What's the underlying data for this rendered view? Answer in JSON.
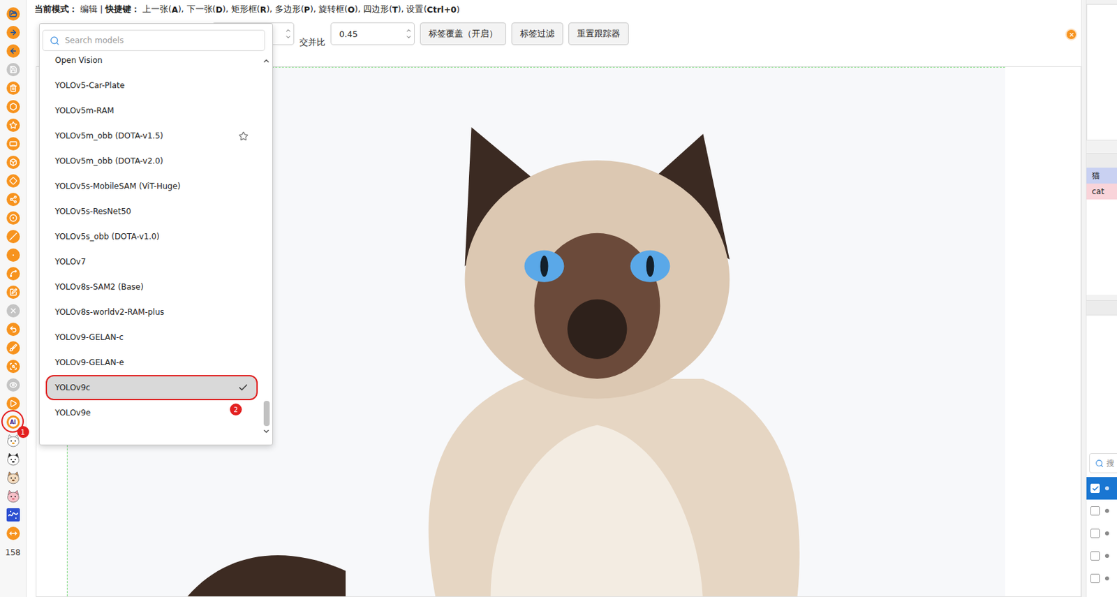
{
  "hint": [
    {
      "text": "当前模式：",
      "bold": true
    },
    {
      "text": " 编辑 | ",
      "bold": false
    },
    {
      "text": "快捷键：",
      "bold": true
    },
    {
      "text": " 上一张(",
      "bold": false
    },
    {
      "text": "A",
      "bold": true
    },
    {
      "text": "), 下一张(",
      "bold": false
    },
    {
      "text": "D",
      "bold": true
    },
    {
      "text": "), 矩形框(",
      "bold": false
    },
    {
      "text": "R",
      "bold": true
    },
    {
      "text": "), 多边形(",
      "bold": false
    },
    {
      "text": "P",
      "bold": true
    },
    {
      "text": "), 旋转框(",
      "bold": false
    },
    {
      "text": "O",
      "bold": true
    },
    {
      "text": "), 四边形(",
      "bold": false
    },
    {
      "text": "T",
      "bold": true
    },
    {
      "text": "), 设置(",
      "bold": false
    },
    {
      "text": "Ctrl+0",
      "bold": true
    },
    {
      "text": ")",
      "bold": false
    }
  ],
  "left_toolbar": {
    "tools": [
      {
        "kind": "round",
        "disabled": false
      },
      {
        "kind": "round",
        "disabled": false
      },
      {
        "kind": "round",
        "disabled": false
      },
      {
        "kind": "round",
        "disabled": true
      },
      {
        "kind": "round",
        "disabled": false
      },
      {
        "kind": "round",
        "disabled": false
      },
      {
        "kind": "round",
        "disabled": false
      },
      {
        "kind": "round",
        "disabled": false
      },
      {
        "kind": "round",
        "disabled": false
      },
      {
        "kind": "round",
        "disabled": false
      },
      {
        "kind": "round",
        "disabled": false
      },
      {
        "kind": "round",
        "disabled": false
      },
      {
        "kind": "round",
        "disabled": false
      },
      {
        "kind": "round",
        "disabled": false
      },
      {
        "kind": "round",
        "disabled": false
      },
      {
        "kind": "round",
        "disabled": false
      },
      {
        "kind": "round",
        "disabled": true
      },
      {
        "kind": "round",
        "disabled": false
      },
      {
        "kind": "round",
        "disabled": false
      },
      {
        "kind": "round",
        "disabled": false
      },
      {
        "kind": "round",
        "disabled": true
      },
      {
        "kind": "round",
        "disabled": false
      },
      {
        "kind": "round",
        "disabled": false,
        "label": "AI",
        "annotation": "1"
      },
      {
        "kind": "mascot",
        "disabled": false
      },
      {
        "kind": "mascot",
        "disabled": false
      },
      {
        "kind": "mascot",
        "disabled": false
      },
      {
        "kind": "mascot",
        "disabled": false
      },
      {
        "kind": "tile",
        "disabled": false
      },
      {
        "kind": "round",
        "disabled": false
      }
    ],
    "count": "158"
  },
  "options": {
    "iou_label": "交并比",
    "iou_value": "0.45",
    "buttons": [
      "标签覆盖（开启）",
      "标签过滤",
      "重置跟踪器"
    ]
  },
  "model_menu": {
    "search_placeholder": "Search models",
    "models": [
      {
        "name": "Open Vision",
        "selected": false,
        "starred": false
      },
      {
        "name": "YOLOv5-Car-Plate",
        "selected": false,
        "starred": false
      },
      {
        "name": "YOLOv5m-RAM",
        "selected": false,
        "starred": false
      },
      {
        "name": "YOLOv5m_obb (DOTA-v1.5)",
        "selected": false,
        "starred": true
      },
      {
        "name": "YOLOv5m_obb (DOTA-v2.0)",
        "selected": false,
        "starred": false
      },
      {
        "name": "YOLOv5s-MobileSAM (ViT-Huge)",
        "selected": false,
        "starred": false
      },
      {
        "name": "YOLOv5s-ResNet50",
        "selected": false,
        "starred": false
      },
      {
        "name": "YOLOv5s_obb (DOTA-v1.0)",
        "selected": false,
        "starred": false
      },
      {
        "name": "YOLOv7",
        "selected": false,
        "starred": false
      },
      {
        "name": "YOLOv8s-SAM2 (Base)",
        "selected": false,
        "starred": false
      },
      {
        "name": "YOLOv8s-worldv2-RAM-plus",
        "selected": false,
        "starred": false
      },
      {
        "name": "YOLOv9-GELAN-c",
        "selected": false,
        "starred": false
      },
      {
        "name": "YOLOv9-GELAN-e",
        "selected": false,
        "starred": false
      },
      {
        "name": "YOLOv9c",
        "selected": true,
        "starred": false,
        "annotation": "2"
      },
      {
        "name": "YOLOv9e",
        "selected": false,
        "starred": false
      }
    ]
  },
  "right_panel": {
    "labels": [
      {
        "text": "猫",
        "color": "#c9d1f2"
      },
      {
        "text": "cat",
        "color": "#f9d4da"
      }
    ],
    "search_placeholder": "搜",
    "shapes": [
      {
        "checked": true,
        "selected": true
      },
      {
        "checked": false,
        "selected": false
      },
      {
        "checked": false,
        "selected": false
      },
      {
        "checked": false,
        "selected": false
      },
      {
        "checked": false,
        "selected": false
      }
    ]
  }
}
